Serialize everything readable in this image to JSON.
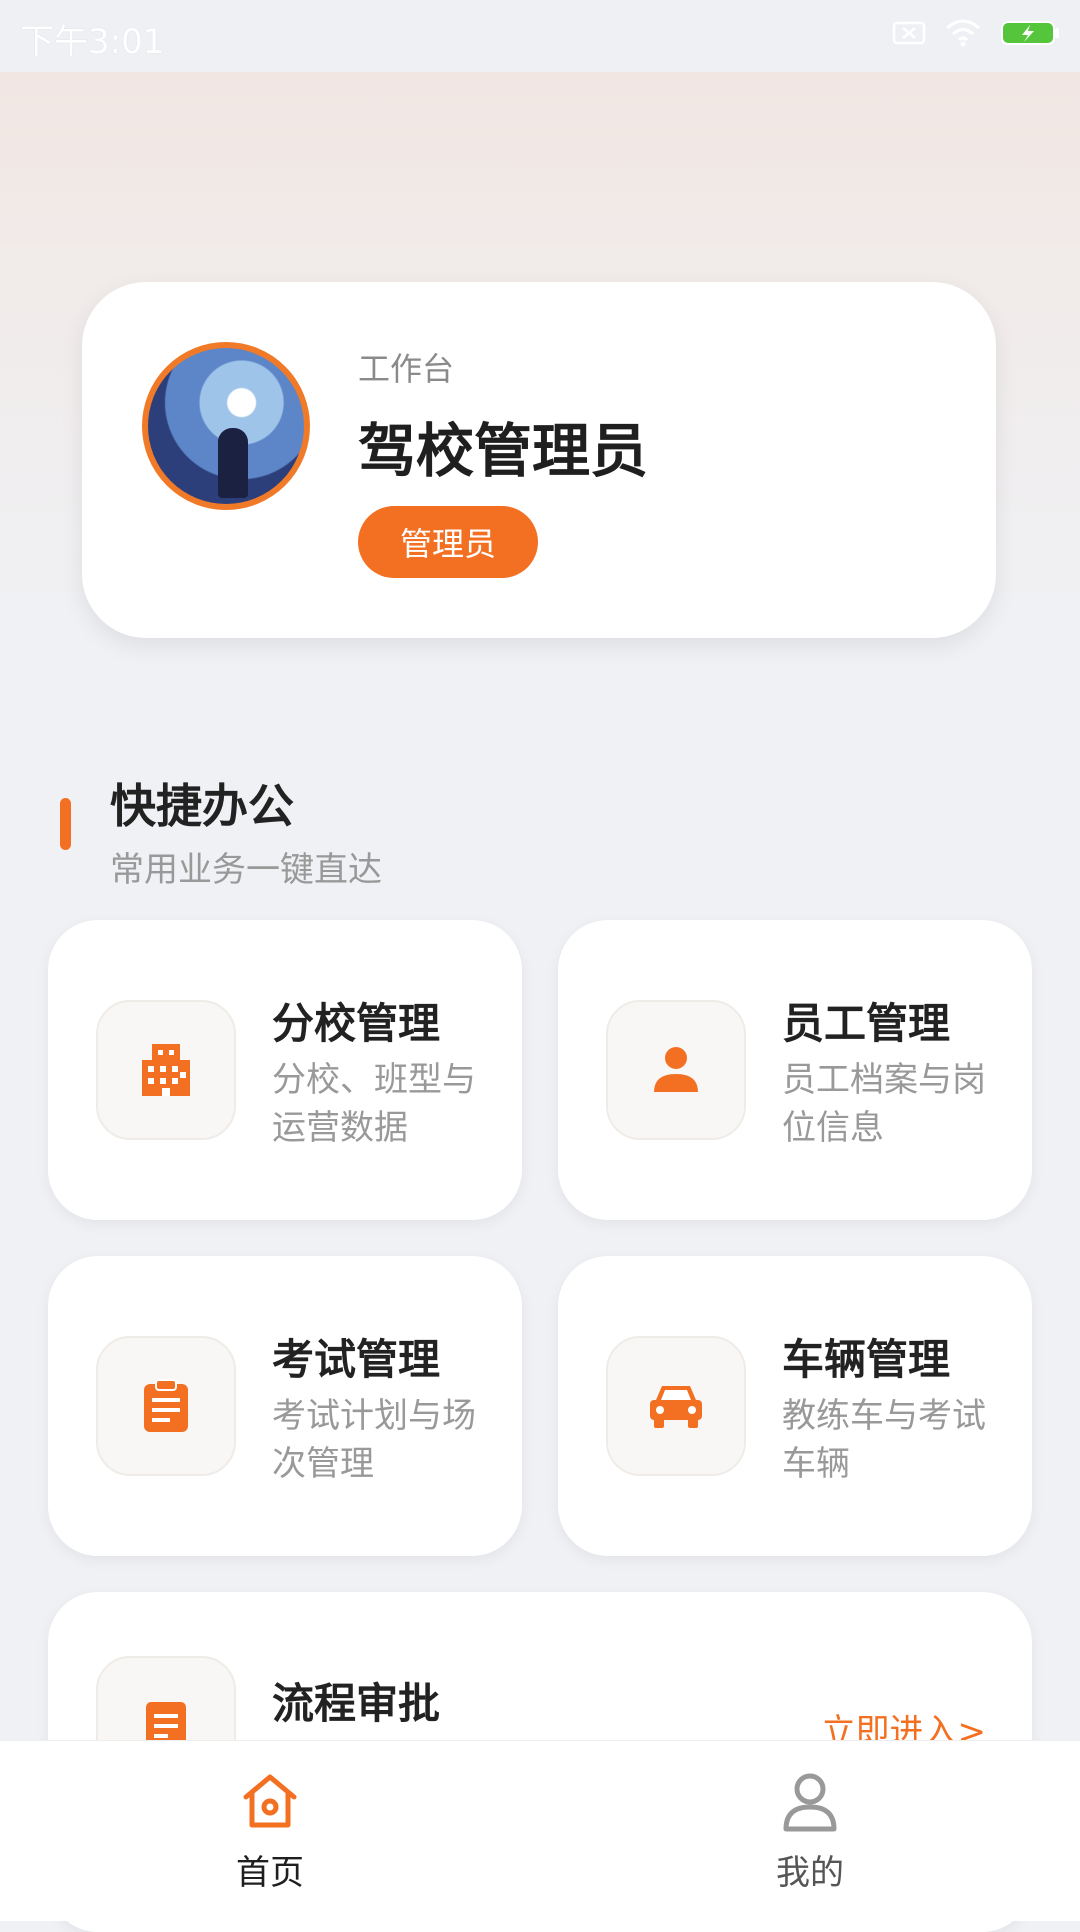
{
  "status_bar": {
    "time": "下午3:01"
  },
  "profile": {
    "subtitle": "工作台",
    "name": "驾校管理员",
    "role": "管理员"
  },
  "section": {
    "title": "快捷办公",
    "subtitle": "常用业务一键直达"
  },
  "tiles": [
    {
      "title": "分校管理",
      "desc": "分校、班型与运营数据",
      "icon": "building-icon"
    },
    {
      "title": "员工管理",
      "desc": "员工档案与岗位信息",
      "icon": "person-icon"
    },
    {
      "title": "考试管理",
      "desc": "考试计划与场次管理",
      "icon": "clipboard-icon"
    },
    {
      "title": "车辆管理",
      "desc": "教练车与考试车辆",
      "icon": "car-icon"
    }
  ],
  "approval": {
    "title": "流程审批",
    "link": "立即进入>",
    "icon": "document-icon"
  },
  "tabbar": {
    "home": "首页",
    "mine": "我的"
  },
  "colors": {
    "accent": "#f37022"
  }
}
